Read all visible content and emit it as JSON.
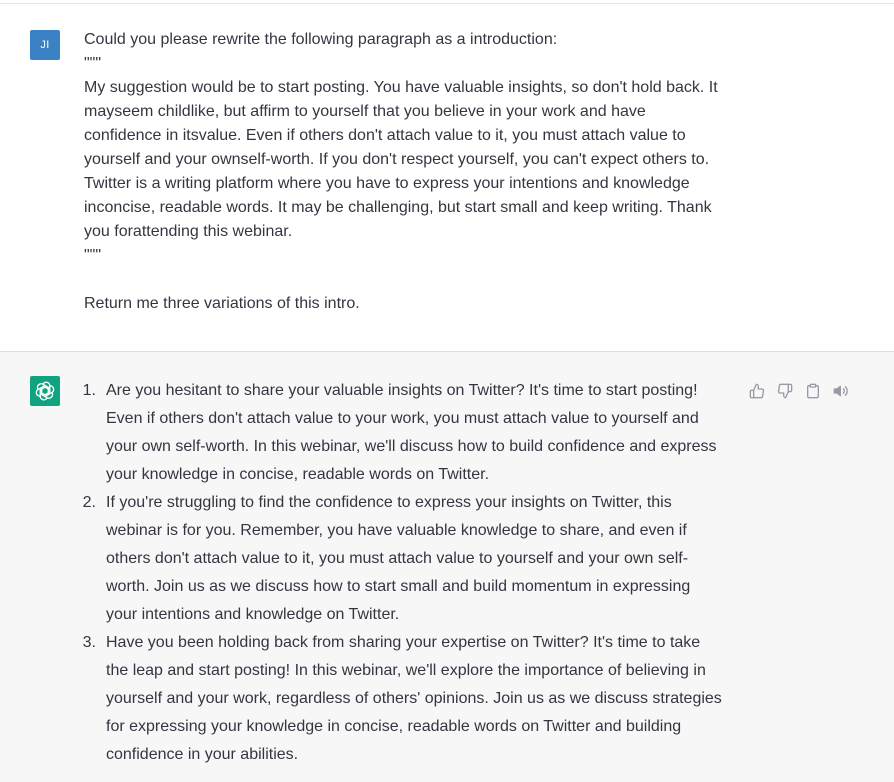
{
  "user": {
    "avatar_initials": "JI",
    "lines": [
      "Could you please rewrite the following paragraph as a introduction:",
      "\"\"\"",
      "My suggestion would be to start posting. You have valuable insights, so don't hold back. It",
      "mayseem childlike, but affirm to yourself that you believe in your work and have",
      "confidence in itsvalue. Even if others don't attach value to it, you must attach value to",
      "yourself and your ownself-worth. If you don't respect yourself, you can't expect others to.",
      "Twitter is a writing platform where you have to express your intentions and knowledge",
      "inconcise, readable words. It may be challenging, but start small and keep writing. Thank",
      "you forattending this webinar.",
      "\"\"\""
    ],
    "closing": "Return me three variations of this intro."
  },
  "assistant": {
    "items": [
      {
        "number": "1.",
        "lines": [
          "Are you hesitant to share your valuable insights on Twitter? It's time to start posting!",
          "Even if others don't attach value to your work, you must attach value to yourself and",
          "your own self-worth. In this webinar, we'll discuss how to build confidence and express",
          "your knowledge in concise, readable words on Twitter."
        ]
      },
      {
        "number": "2.",
        "lines": [
          "If you're struggling to find the confidence to express your insights on Twitter, this",
          "webinar is for you. Remember, you have valuable knowledge to share, and even if",
          "others don't attach value to it, you must attach value to yourself and your own self-",
          "worth. Join us as we discuss how to start small and build momentum in expressing",
          "your intentions and knowledge on Twitter."
        ]
      },
      {
        "number": "3.",
        "lines": [
          "Have you been holding back from sharing your expertise on Twitter? It's time to take",
          "the leap and start posting! In this webinar, we'll explore the importance of believing in",
          "yourself and your work, regardless of others' opinions. Join us as we discuss strategies",
          "for expressing your knowledge in concise, readable words on Twitter and building",
          "confidence in your abilities."
        ]
      }
    ],
    "actions": [
      "thumbs-up-icon",
      "thumbs-down-icon",
      "clipboard-icon",
      "speaker-icon"
    ]
  },
  "colors": {
    "user_avatar": "#3b82c4",
    "bot_avatar": "#10a37f",
    "assistant_bg": "#f7f7f8",
    "text": "#343541",
    "icon": "#9a9aa6"
  }
}
